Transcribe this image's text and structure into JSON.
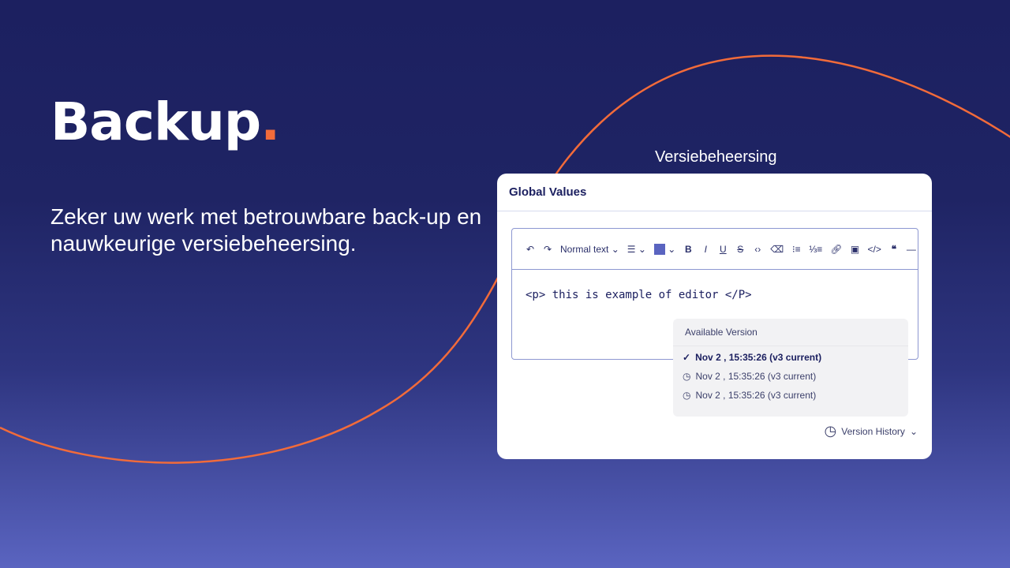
{
  "hero": {
    "title": "Backup",
    "title_dot": ".",
    "subtitle": "Zeker uw werk met betrouwbare back-up en nauwkeurige versiebeheersing."
  },
  "colors": {
    "accent": "#f26b3a",
    "brand": "#1c2060",
    "swatch": "#5a64c0"
  },
  "caption": "Versiebeheersing",
  "card": {
    "title": "Global Values",
    "toolbar": {
      "text_style": "Normal text",
      "icons": [
        "undo-icon",
        "redo-icon",
        "align-icon",
        "text-color",
        "bold-icon",
        "italic-icon",
        "underline-icon",
        "strikethrough-icon",
        "code-inline-icon",
        "clear-format-icon",
        "bullet-list-icon",
        "numbered-list-icon",
        "link-icon",
        "image-icon",
        "code-block-icon",
        "quote-icon",
        "horizontal-rule-icon"
      ]
    },
    "editor_content": "<p> this is example of editor </P>",
    "versions": {
      "header": "Available Version",
      "items": [
        {
          "label": "Nov 2 , 15:35:26 (v3 current)",
          "icon": "check-icon",
          "current": true
        },
        {
          "label": "Nov 2 , 15:35:26 (v3 current)",
          "icon": "clock-icon",
          "current": false
        },
        {
          "label": "Nov 2 , 15:35:26 (v3 current)",
          "icon": "clock-icon",
          "current": false
        }
      ]
    },
    "version_history_label": "Version History"
  }
}
